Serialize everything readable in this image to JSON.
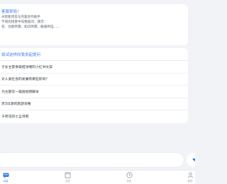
{
  "intro": {
    "title": "客服来啦！",
    "lines": [
      "AI智能问答与内容创作助手",
      "不同的场景中向我提问，我可：",
      "答、创意所需、知识所需、解惑所选......"
    ]
  },
  "suggestions": {
    "header": "尝试这样向我发起提问",
    "items": [
      "于女主夏季穿搭攻略的小红书文案",
      "对人类社会的发展有哪些影响？",
      "为主题写一篇短视频脚本",
      "京3日游的旅游攻略",
      "于荷花的七言诗吧"
    ]
  },
  "input": {
    "value": "",
    "placeholder": ""
  },
  "tabbar": {
    "tabs": [
      {
        "label": "对话",
        "icon": "chat-icon",
        "active": true
      },
      {
        "label": "文档",
        "icon": "document-icon",
        "active": false
      },
      {
        "label": "历史",
        "icon": "clock-icon",
        "active": false
      },
      {
        "label": "我的",
        "icon": "profile-icon",
        "active": false
      }
    ]
  },
  "colors": {
    "accent": "#3a7be8",
    "background": "#f1f3f7",
    "card": "#ffffff",
    "muted": "#9aa1ab"
  }
}
